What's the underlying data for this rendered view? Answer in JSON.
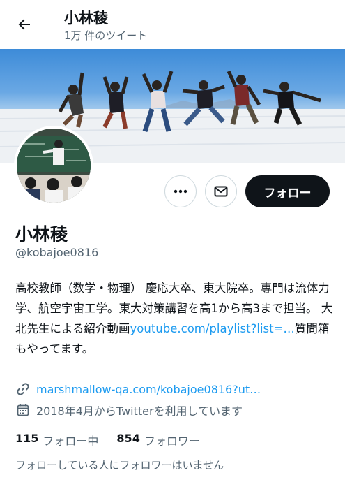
{
  "header": {
    "title": "小林稜",
    "tweet_count": "1万 件のツイート",
    "back_icon": "arrow-left-icon"
  },
  "banner": {
    "image": "people-jumping-on-salt-flat-photo"
  },
  "avatar": {
    "image": "classroom-teacher-photo"
  },
  "actions": {
    "more_icon": "more-horizontal-icon",
    "message_icon": "envelope-icon",
    "follow_label": "フォロー"
  },
  "profile": {
    "name": "小林稜",
    "handle": "@kobajoe0816",
    "bio_part1": "高校教師（数学・物理） 慶応大卒、東大院卒。専門は流体力学、航空宇宙工学。東大対策講習を高1から高3まで担当。 大北先生による紹介動画",
    "bio_link": "youtube.com/playlist?list=…",
    "bio_part2": "質問箱もやってます。",
    "website": "marshmallow-qa.com/kobajoe0816?ut…",
    "joined": "2018年4月からTwitterを利用しています"
  },
  "stats": {
    "following_count": "115",
    "following_label": "フォロー中",
    "followers_count": "854",
    "followers_label": "フォロワー"
  },
  "note": "フォローしている人にフォロワーはいません",
  "colors": {
    "accent": "#1d9bf0",
    "text": "#0f1419",
    "muted": "#536471"
  }
}
